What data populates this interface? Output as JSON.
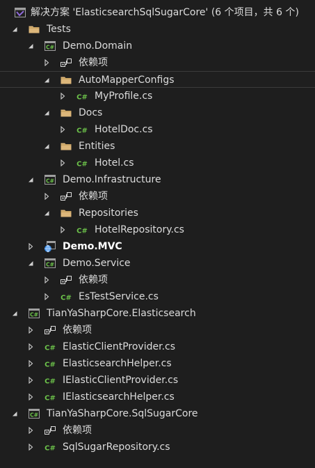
{
  "solution": {
    "label": "解决方案 'ElasticsearchSqlSugarCore' (6 个项目，共 6 个)"
  },
  "nodes": [
    {
      "label": "Tests",
      "icon": "folder-icon",
      "expanded": true
    },
    {
      "label": "Demo.Domain",
      "icon": "csharp-project-icon",
      "expanded": true
    },
    {
      "label": "依赖项",
      "icon": "dependencies-icon",
      "expanded": false
    },
    {
      "label": "AutoMapperConfigs",
      "icon": "folder-icon",
      "expanded": true,
      "selected": true
    },
    {
      "label": "MyProfile.cs",
      "icon": "csharp-file-icon",
      "expanded": false
    },
    {
      "label": "Docs",
      "icon": "folder-icon",
      "expanded": true
    },
    {
      "label": "HotelDoc.cs",
      "icon": "csharp-file-icon",
      "expanded": false
    },
    {
      "label": "Entities",
      "icon": "folder-icon",
      "expanded": true
    },
    {
      "label": "Hotel.cs",
      "icon": "csharp-file-icon",
      "expanded": false
    },
    {
      "label": "Demo.Infrastructure",
      "icon": "csharp-project-icon",
      "expanded": true
    },
    {
      "label": "依赖项",
      "icon": "dependencies-icon",
      "expanded": false
    },
    {
      "label": "Repositories",
      "icon": "folder-icon",
      "expanded": true
    },
    {
      "label": "HotelRepository.cs",
      "icon": "csharp-file-icon",
      "expanded": false
    },
    {
      "label": "Demo.MVC",
      "icon": "web-project-icon",
      "expanded": false,
      "bold": true
    },
    {
      "label": "Demo.Service",
      "icon": "csharp-project-icon",
      "expanded": true
    },
    {
      "label": "依赖项",
      "icon": "dependencies-icon",
      "expanded": false
    },
    {
      "label": "EsTestService.cs",
      "icon": "csharp-file-icon",
      "expanded": false
    },
    {
      "label": "TianYaSharpCore.Elasticsearch",
      "icon": "csharp-project-icon",
      "expanded": true
    },
    {
      "label": "依赖项",
      "icon": "dependencies-icon",
      "expanded": false
    },
    {
      "label": "ElasticClientProvider.cs",
      "icon": "csharp-file-icon",
      "expanded": false
    },
    {
      "label": "ElasticsearchHelper.cs",
      "icon": "csharp-file-icon",
      "expanded": false
    },
    {
      "label": "IElasticClientProvider.cs",
      "icon": "csharp-file-icon",
      "expanded": false
    },
    {
      "label": "IElasticsearchHelper.cs",
      "icon": "csharp-file-icon",
      "expanded": false
    },
    {
      "label": "TianYaSharpCore.SqlSugarCore",
      "icon": "csharp-project-icon",
      "expanded": true
    },
    {
      "label": "依赖项",
      "icon": "dependencies-icon",
      "expanded": false
    },
    {
      "label": "SqlSugarRepository.cs",
      "icon": "csharp-file-icon",
      "expanded": false
    }
  ],
  "colors": {
    "background": "#1e1e1e",
    "text": "#dcdcdc",
    "folder": "#dcb67a",
    "csharp": "#6cc24a",
    "project_border": "#a0a0a0",
    "solution": "#8f6ad9",
    "web": "#3b8ee8"
  }
}
